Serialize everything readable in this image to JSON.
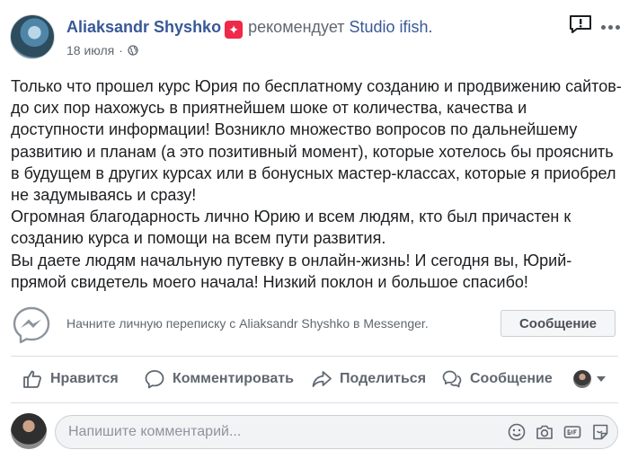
{
  "header": {
    "author": "Aliaksandr Shyshko",
    "verb": "рекомендует",
    "page": "Studio ifish.",
    "date": "18 июля",
    "separator": "·"
  },
  "post": {
    "paragraphs": [
      "Только что прошел курс Юрия по бесплатному созданию и продвижению сайтов-до сих пор нахожусь в приятнейшем шоке от количества, качества и доступности информации! Возникло множество вопросов по дальнейшему развитию и планам (а это позитивный момент), которые хотелось бы прояснить в будущем в других курсах или в бонусных мастер-классах, которые я приобрел не задумываясь и сразу!",
      "Огромная благодарность лично Юрию и всем людям, кто был причастен к созданию курса и помощи на всем пути развития.",
      "Вы даете людям начальную путевку в онлайн-жизнь! И сегодня вы, Юрий-прямой свидетель моего начала! Низкий поклон и большое спасибо!"
    ]
  },
  "messenger": {
    "prompt": "Начните личную переписку с Aliaksandr Shyshko в Messenger.",
    "button": "Сообщение"
  },
  "actions": {
    "like": "Нравится",
    "comment": "Комментировать",
    "share": "Поделиться",
    "message": "Сообщение"
  },
  "composer": {
    "placeholder": "Напишите комментарий..."
  },
  "colors": {
    "link": "#385898",
    "recommend_badge": "#f02849",
    "secondary_text": "#606770"
  },
  "icons": [
    "recommend-icon",
    "globe-icon",
    "report-icon",
    "more-icon",
    "messenger-icon",
    "like-icon",
    "comment-icon",
    "share-icon",
    "message-icon",
    "emoji-icon",
    "camera-icon",
    "gif-icon",
    "sticker-icon"
  ]
}
